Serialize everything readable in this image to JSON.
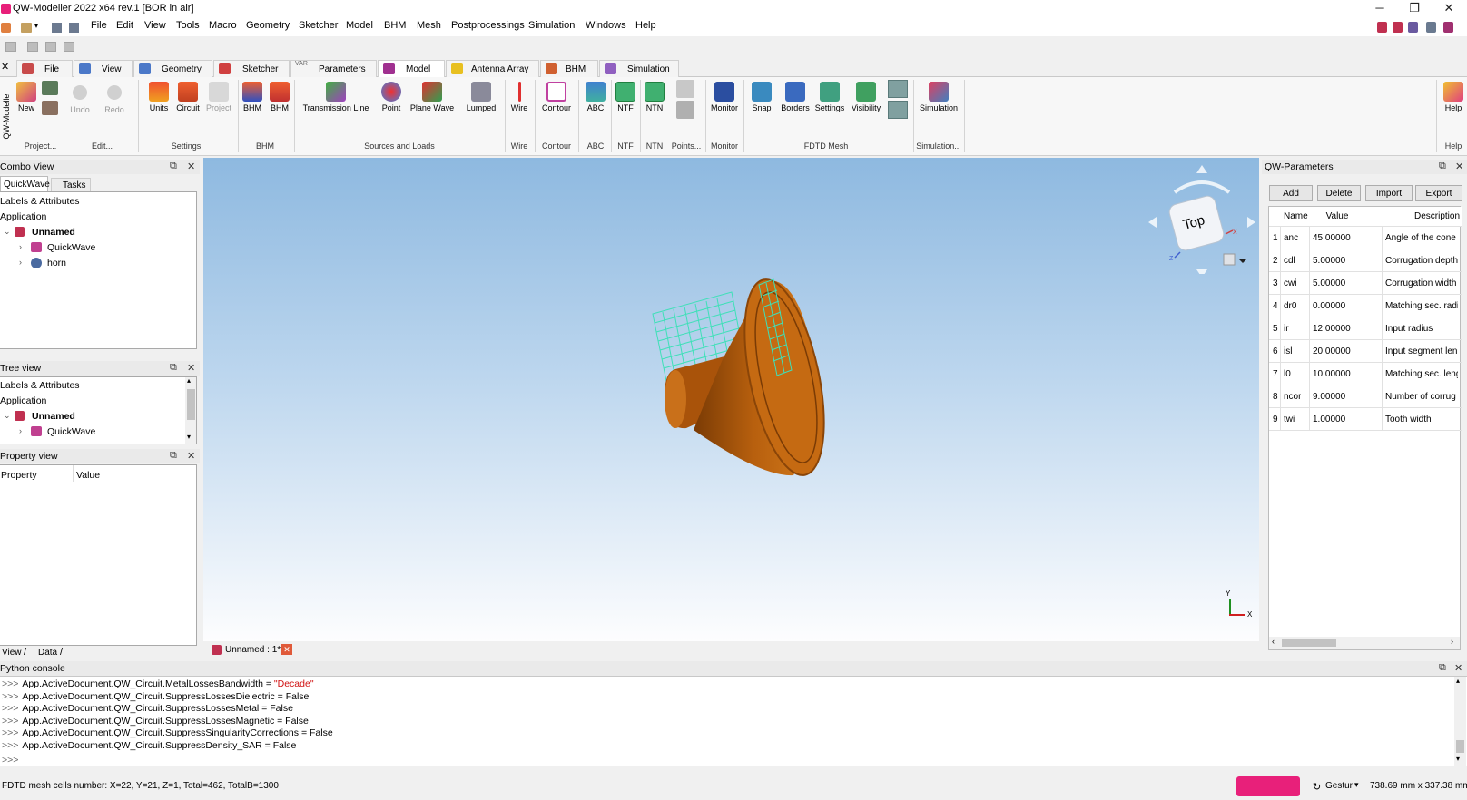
{
  "window": {
    "title": "QW-Modeller 2022 x64 rev.1 [BOR in air]",
    "minimize": "─",
    "restore": "❐",
    "close": "✕"
  },
  "menu": [
    "File",
    "Edit",
    "View",
    "Tools",
    "Macro",
    "Geometry",
    "Sketcher",
    "Model",
    "BHM",
    "Mesh",
    "Postprocessings",
    "Simulation",
    "Windows",
    "Help"
  ],
  "tabs": [
    {
      "label": "File",
      "color": "#c84b4b"
    },
    {
      "label": "View",
      "color": "#4b78c8"
    },
    {
      "label": "Geometry",
      "color": "#4b78c8"
    },
    {
      "label": "Sketcher",
      "color": "#d04040"
    },
    {
      "label": "Parameters",
      "color": "#888888",
      "prefix": "VAR"
    },
    {
      "label": "Model",
      "color": "#a03090"
    },
    {
      "label": "Antenna Array",
      "color": "#e8c020"
    },
    {
      "label": "BHM",
      "color": "#d06030"
    },
    {
      "label": "Simulation",
      "color": "#9060c0"
    }
  ],
  "ribbon": {
    "side_label": "QW-Modeller",
    "buttons": {
      "new": "New",
      "undo": "Undo",
      "redo": "Redo",
      "units": "Units",
      "circuit": "Circuit",
      "project": "Project",
      "bhm1": "BHM",
      "bhm2": "BHM",
      "tline": "Transmission Line",
      "point": "Point",
      "planewave": "Plane Wave",
      "lumped": "Lumped",
      "wire": "Wire",
      "contour": "Contour",
      "abc": "ABC",
      "ntf": "NTF",
      "ntn": "NTN",
      "monitor": "Monitor",
      "snap": "Snap",
      "borders": "Borders",
      "settings": "Settings",
      "visibility": "Visibility",
      "simulation": "Simulation",
      "help": "Help"
    },
    "groups": {
      "project": "Project...",
      "edit": "Edit...",
      "settings": "Settings",
      "bhm": "BHM",
      "sources": "Sources and Loads",
      "wire": "Wire",
      "contour": "Contour",
      "abc": "ABC",
      "ntf": "NTF",
      "ntn": "NTN",
      "points": "Points...",
      "monitor": "Monitor",
      "fdtd": "FDTD Mesh",
      "simulation": "Simulation...",
      "help": "Help"
    }
  },
  "combo_view": {
    "title": "Combo View",
    "tabs": [
      "QuickWave",
      "Tasks"
    ],
    "rows": [
      "Labels & Attributes",
      "Application",
      "Unnamed",
      "QuickWave",
      "horn"
    ],
    "bottom_tabs": [
      "View",
      "Data"
    ]
  },
  "tree_view": {
    "title": "Tree view",
    "rows": [
      "Labels & Attributes",
      "Application",
      "Unnamed",
      "QuickWave"
    ]
  },
  "property_view": {
    "title": "Property view",
    "col_property": "Property",
    "col_value": "Value"
  },
  "viewport": {
    "doc_tab": "Unnamed : 1*",
    "nav_cube": "Top",
    "axis_x": "X",
    "axis_y": "Y",
    "axis_z": "Z"
  },
  "params": {
    "title": "QW-Parameters",
    "buttons": [
      "Add",
      "Delete",
      "Import",
      "Export"
    ],
    "columns": [
      "Name",
      "Value",
      "Description"
    ],
    "rows": [
      {
        "n": "1",
        "name": "anc",
        "value": "45.00000",
        "desc": "Angle of the cone"
      },
      {
        "n": "2",
        "name": "cdl",
        "value": "5.00000",
        "desc": "Corrugation depth"
      },
      {
        "n": "3",
        "name": "cwi",
        "value": "5.00000",
        "desc": "Corrugation width"
      },
      {
        "n": "4",
        "name": "dr0",
        "value": "0.00000",
        "desc": "Matching sec. radi"
      },
      {
        "n": "5",
        "name": "ir",
        "value": "12.00000",
        "desc": "Input radius"
      },
      {
        "n": "6",
        "name": "isl",
        "value": "20.00000",
        "desc": "Input segment len"
      },
      {
        "n": "7",
        "name": "l0",
        "value": "10.00000",
        "desc": "Matching sec. leng"
      },
      {
        "n": "8",
        "name": "ncor",
        "value": "9.00000",
        "desc": "Number of corrug"
      },
      {
        "n": "9",
        "name": "twi",
        "value": "1.00000",
        "desc": "Tooth width"
      }
    ]
  },
  "console": {
    "title": "Python console",
    "prompt": ">>>",
    "lines": [
      {
        "code": "App.ActiveDocument.QW_Circuit.MetalLossesBandwidth = ",
        "str": "\"Decade\""
      },
      {
        "code": "App.ActiveDocument.QW_Circuit.SuppressLossesDielectric = False",
        "str": ""
      },
      {
        "code": "App.ActiveDocument.QW_Circuit.SuppressLossesMetal = False",
        "str": ""
      },
      {
        "code": "App.ActiveDocument.QW_Circuit.SuppressLossesMagnetic = False",
        "str": ""
      },
      {
        "code": "App.ActiveDocument.QW_Circuit.SuppressSingularityCorrections = False",
        "str": ""
      },
      {
        "code": "App.ActiveDocument.QW_Circuit.SuppressDensity_SAR = False",
        "str": ""
      }
    ]
  },
  "status": {
    "left": "FDTD mesh cells number: X=22, Y=21, Z=1, Total=462, TotalB=1300",
    "nav": "Gestur",
    "dims": "738.69 mm x 337.38 mm"
  },
  "colors": {
    "horn": "#c1650f",
    "mesh": "#3fe0b8",
    "accent": "#e8207a"
  }
}
